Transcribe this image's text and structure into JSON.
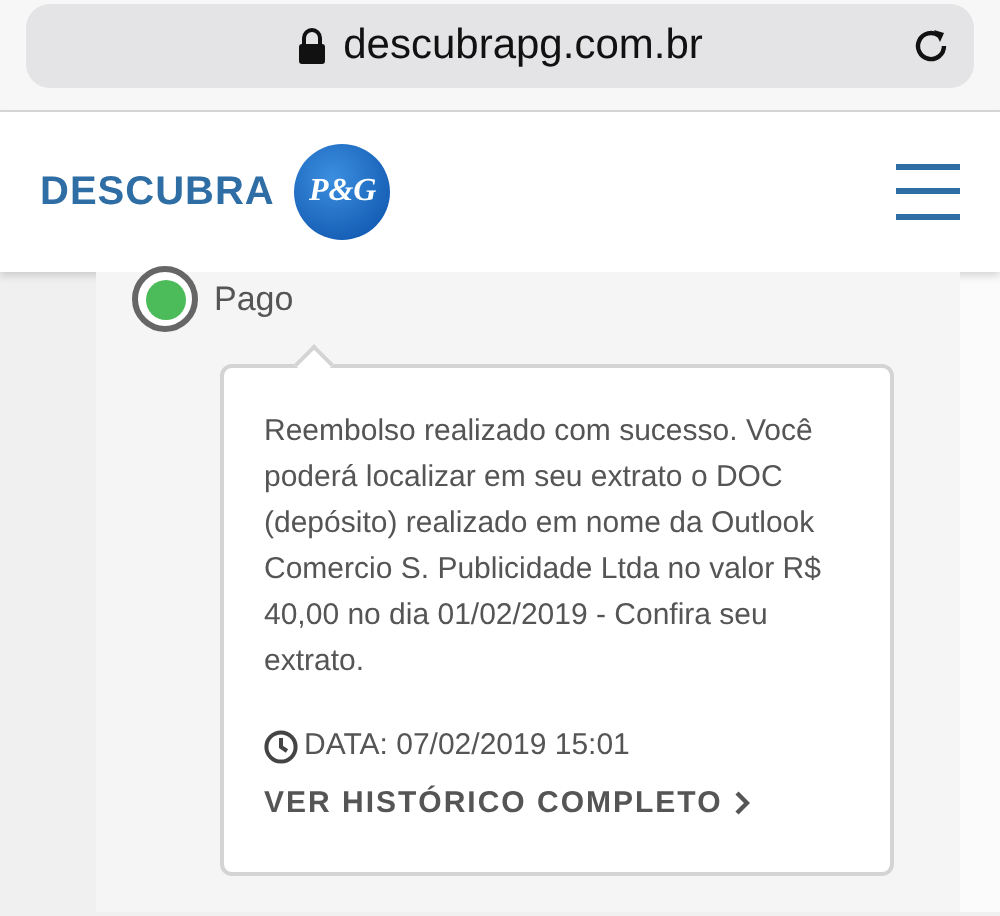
{
  "browser": {
    "url": "descubrapg.com.br"
  },
  "header": {
    "brand": "DESCUBRA",
    "logo_text": "P&G"
  },
  "status": {
    "label": "Pago",
    "color": "#4cbb5a"
  },
  "message": {
    "text": "Reembolso realizado com sucesso. Você poderá localizar em seu extrato o DOC (depósito) realizado em nome da Outlook Comercio S. Publicidade Ltda no valor R$ 40,00 no dia 01/02/2019 - Confira seu extrato.",
    "date": "DATA: 07/02/2019 15:01",
    "link": "VER HISTÓRICO COMPLETO"
  }
}
